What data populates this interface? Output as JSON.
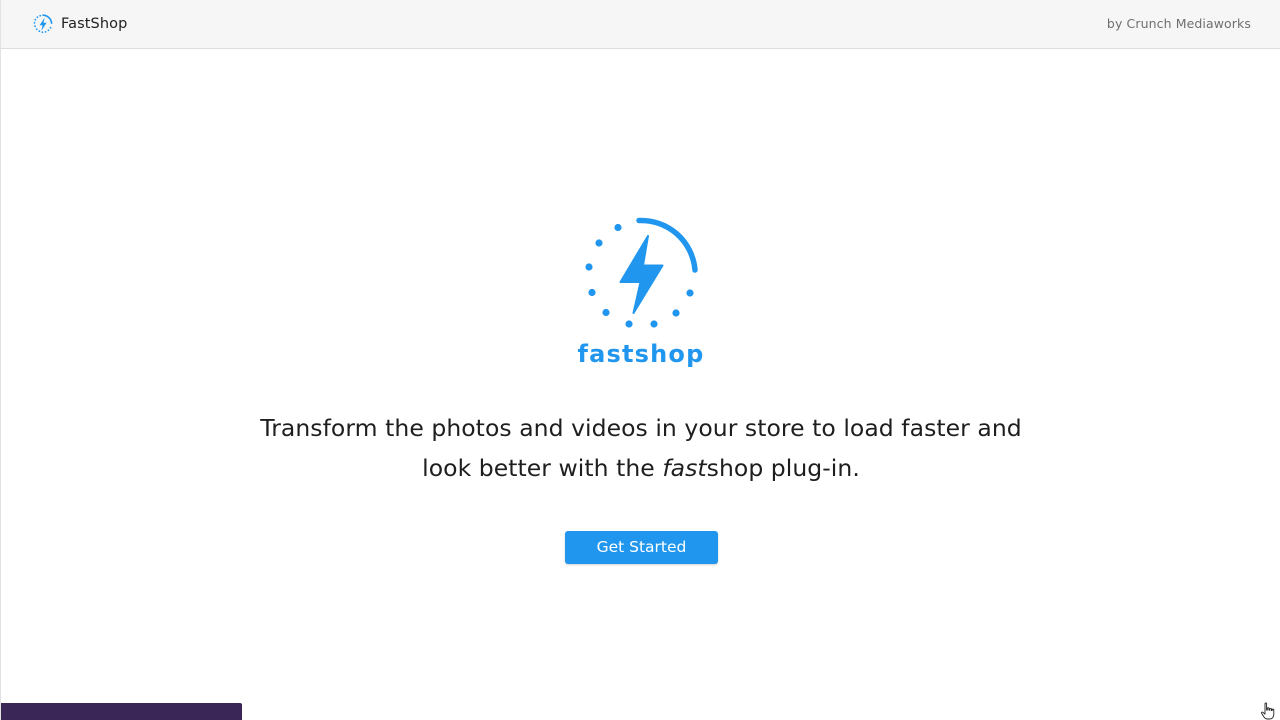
{
  "header": {
    "app_name": "FastShop",
    "byline": "by Crunch Mediaworks",
    "logo_icon": "lightning-bolt-icon"
  },
  "hero": {
    "logo_icon": "lightning-bolt-loader-icon",
    "wordmark": "fastshop",
    "headline_part1": "Transform the photos and videos in your store to load faster and look better with the ",
    "headline_emphasis": "fast",
    "headline_part2": "shop plug-in.",
    "cta_label": "Get Started"
  },
  "colors": {
    "brand_blue": "#2196ef",
    "topbar_bg": "#f6f6f6",
    "bottom_bar": "#3b2658"
  }
}
